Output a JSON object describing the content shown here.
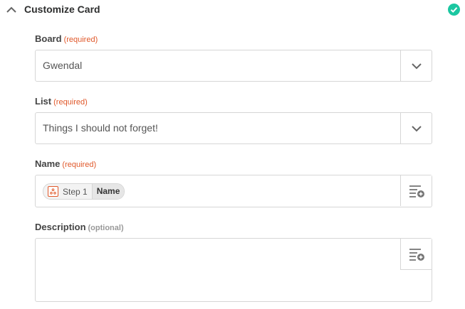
{
  "section": {
    "title": "Customize Card"
  },
  "fields": {
    "board": {
      "label": "Board",
      "requirement": "(required)",
      "value": "Gwendal"
    },
    "list": {
      "label": "List",
      "requirement": "(required)",
      "value": "Things I should not forget!"
    },
    "name": {
      "label": "Name",
      "requirement": "(required)",
      "token": {
        "step": "Step 1",
        "field": "Name"
      }
    },
    "description": {
      "label": "Description",
      "requirement": "(optional)",
      "value": ""
    }
  },
  "colors": {
    "required": "#e0582a",
    "success": "#1bc7a1",
    "border": "#d6d6d6"
  }
}
